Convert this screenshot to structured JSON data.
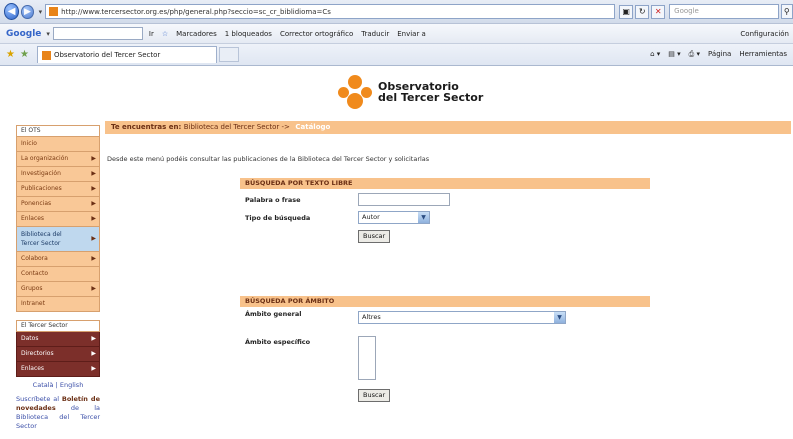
{
  "browser": {
    "url": "http://www.tercersector.org.es/php/general.php?seccio=sc_cr_biblidioma=Cs",
    "search_placeholder": "Google",
    "toolbar": {
      "google_label": "Google",
      "go_label": "Ir",
      "bookmarks_label": "Marcadores",
      "blocked_label": "1 bloqueados",
      "spell_label": "Corrector ortográfico",
      "translate_label": "Traducir",
      "send_label": "Enviar a",
      "settings_label": "Configuración"
    },
    "tab_title": "Observatorio del Tercer Sector",
    "tab_tools": {
      "page_label": "Página",
      "tools_label": "Herramientas"
    }
  },
  "site": {
    "logo_line1": "Observatorio",
    "logo_line2": "del Tercer Sector",
    "breadcrumb_prefix": "Te encuentras en:",
    "breadcrumb_path": "Biblioteca del Tercer Sector ->",
    "breadcrumb_current": "Catálogo",
    "intro": "Desde este menú podéis consultar las publicaciones de la Biblioteca del Tercer Sector y solicitarlas"
  },
  "sidebar": {
    "ots_header": "El OTS",
    "ots_items": [
      {
        "label": "Inicio",
        "arrow": false
      },
      {
        "label": "La organización",
        "arrow": true
      },
      {
        "label": "Investigación",
        "arrow": true
      },
      {
        "label": "Publicaciones",
        "arrow": true
      },
      {
        "label": "Ponencias",
        "arrow": true
      },
      {
        "label": "Enlaces",
        "arrow": true
      },
      {
        "label": "Biblioteca del Tercer Sector",
        "arrow": true
      },
      {
        "label": "Colabora",
        "arrow": true
      },
      {
        "label": "Contacto",
        "arrow": false
      },
      {
        "label": "Grupos",
        "arrow": true
      },
      {
        "label": "Intranet",
        "arrow": false
      }
    ],
    "ts_header": "El Tercer Sector",
    "ts_items": [
      {
        "label": "Datos"
      },
      {
        "label": "Directorios"
      },
      {
        "label": "Enlaces"
      }
    ],
    "languages": "Català | English",
    "newsletter_prefix": "Suscríbete al",
    "newsletter_bold": "Boletín de novedades",
    "newsletter_suffix": "de la Biblioteca del Tercer Sector"
  },
  "search_text": {
    "header": "BÚSQUEDA POR TEXTO LIBRE",
    "phrase_label": "Palabra o frase",
    "phrase_value": "",
    "type_label": "Tipo de búsqueda",
    "type_value": "Autor",
    "button": "Buscar"
  },
  "search_scope": {
    "header": "BÚSQUEDA POR ÁMBITO",
    "general_label": "Ámbito general",
    "general_value": "Altres",
    "specific_label": "Ámbito específico",
    "button": "Buscar"
  },
  "colors": {
    "accent_orange": "#f8c28b",
    "brand_orange": "#f08a1c",
    "sidebar_dark": "#7c2f2a",
    "sidebar_active": "#bfd8ee"
  }
}
